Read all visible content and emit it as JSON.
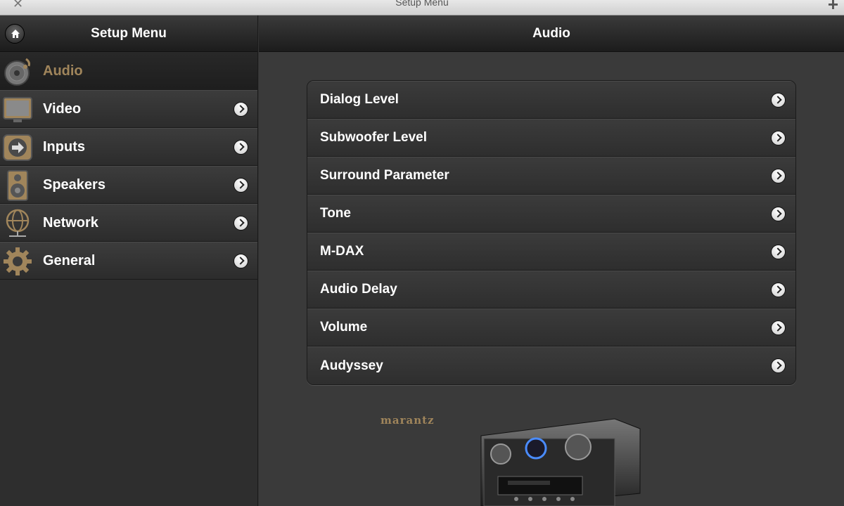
{
  "window": {
    "title": "Setup Menu",
    "close_icon": "close-icon",
    "add_icon": "plus-icon"
  },
  "sidebar": {
    "title": "Setup Menu",
    "items": [
      {
        "label": "Audio",
        "icon": "audio-disc-icon",
        "active": true
      },
      {
        "label": "Video",
        "icon": "monitor-icon"
      },
      {
        "label": "Inputs",
        "icon": "input-arrow-icon"
      },
      {
        "label": "Speakers",
        "icon": "speaker-icon"
      },
      {
        "label": "Network",
        "icon": "globe-icon"
      },
      {
        "label": "General",
        "icon": "gear-icon"
      }
    ]
  },
  "main": {
    "title": "Audio",
    "items": [
      {
        "label": "Dialog Level"
      },
      {
        "label": "Subwoofer Level"
      },
      {
        "label": "Surround Parameter"
      },
      {
        "label": "Tone"
      },
      {
        "label": "M-DAX"
      },
      {
        "label": "Audio Delay"
      },
      {
        "label": "Volume"
      },
      {
        "label": "Audyssey"
      }
    ],
    "brand": "marantz"
  },
  "colors": {
    "accent": "#a0855b",
    "background": "#3a3a3a",
    "panel": "#2e2e2e"
  }
}
